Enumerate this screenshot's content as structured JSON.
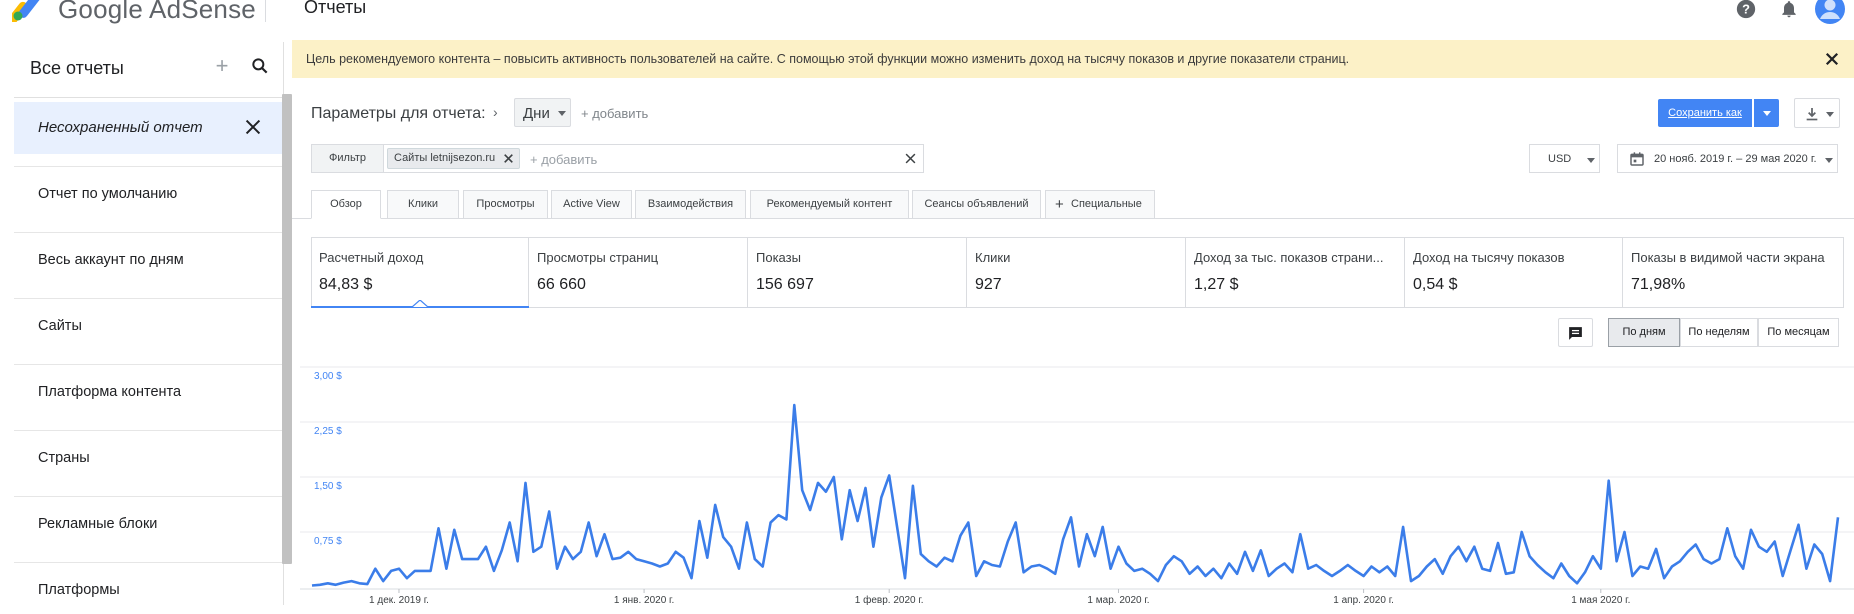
{
  "header": {
    "brand": "Google AdSense",
    "page_title": "Отчеты"
  },
  "sidebar": {
    "title": "Все отчеты",
    "active_item": "Несохраненный отчет",
    "items": [
      {
        "label": "Отчет по умолчанию"
      },
      {
        "label": "Весь аккаунт по дням"
      },
      {
        "label": "Сайты"
      },
      {
        "label": "Платформа контента"
      },
      {
        "label": "Страны"
      },
      {
        "label": "Рекламные блоки"
      },
      {
        "label": "Платформы"
      }
    ]
  },
  "banner": {
    "text": "Цель рекомендуемого контента – повысить активность пользователей на сайте. С помощью этой функции можно изменить доход на тысячу показов и другие показатели страниц."
  },
  "params": {
    "label": "Параметры для отчета:",
    "dimension": "Дни",
    "add": "+ добавить"
  },
  "toolbar": {
    "save_label": "Сохранить как"
  },
  "filter": {
    "label": "Фильтр",
    "chip": "Сайты letnijsezon.ru",
    "add": "+ добавить"
  },
  "currency": "USD",
  "date_range": "20 нояб. 2019 г. – 29 мая 2020 г.",
  "tabs": [
    {
      "label": "Обзор"
    },
    {
      "label": "Клики"
    },
    {
      "label": "Просмотры"
    },
    {
      "label": "Active View"
    },
    {
      "label": "Взаимодействия"
    },
    {
      "label": "Рекомендуемый контент"
    },
    {
      "label": "Сеансы объявлений"
    },
    {
      "label": "Специальные"
    }
  ],
  "metrics": [
    {
      "label": "Расчетный доход",
      "value": "84,83 $"
    },
    {
      "label": "Просмотры страниц",
      "value": "66 660"
    },
    {
      "label": "Показы",
      "value": "156 697"
    },
    {
      "label": "Клики",
      "value": "927"
    },
    {
      "label": "Доход за тыс. показов страни...",
      "value": "1,27 $"
    },
    {
      "label": "Доход на тысячу показов",
      "value": "0,54 $"
    },
    {
      "label": "Показы в видимой части экрана",
      "value": "71,98%"
    }
  ],
  "granularity": [
    {
      "label": "По дням"
    },
    {
      "label": "По неделям"
    },
    {
      "label": "По месяцам"
    }
  ],
  "colors": {
    "accent": "#4285f4",
    "banner_bg": "#fcf1c7",
    "series": "#3b7de9"
  },
  "chart_data": {
    "type": "line",
    "ylim": [
      0,
      3.0
    ],
    "y_ticks": [
      {
        "value": 0.75,
        "label": "0,75 $"
      },
      {
        "value": 1.5,
        "label": "1,50 $"
      },
      {
        "value": 2.25,
        "label": "2,25 $"
      },
      {
        "value": 3.0,
        "label": "3,00 $"
      }
    ],
    "x_ticks": [
      {
        "index": 11,
        "label": "1 дек. 2019 г."
      },
      {
        "index": 42,
        "label": "1 янв. 2020 г."
      },
      {
        "index": 73,
        "label": "1 февр. 2020 г."
      },
      {
        "index": 102,
        "label": "1 мар. 2020 г."
      },
      {
        "index": 133,
        "label": "1 апр. 2020 г."
      },
      {
        "index": 163,
        "label": "1 мая 2020 г."
      }
    ],
    "series": [
      {
        "values": [
          0.02,
          0.03,
          0.05,
          0.03,
          0.06,
          0.08,
          0.05,
          0.04,
          0.25,
          0.08,
          0.22,
          0.25,
          0.12,
          0.22,
          0.22,
          0.22,
          0.8,
          0.25,
          0.78,
          0.38,
          0.38,
          0.38,
          0.55,
          0.22,
          0.5,
          0.88,
          0.35,
          1.42,
          0.48,
          0.55,
          1.03,
          0.25,
          0.55,
          0.38,
          0.48,
          0.88,
          0.42,
          0.72,
          0.38,
          0.4,
          0.48,
          0.38,
          0.35,
          0.32,
          0.28,
          0.32,
          0.48,
          0.4,
          0.12,
          0.9,
          0.4,
          1.12,
          0.68,
          0.55,
          0.25,
          0.88,
          0.38,
          0.28,
          0.88,
          0.98,
          0.92,
          2.48,
          1.32,
          1.05,
          1.42,
          1.3,
          1.5,
          0.65,
          1.32,
          0.9,
          1.35,
          0.55,
          1.22,
          1.52,
          0.82,
          0.12,
          1.38,
          0.45,
          0.35,
          0.28,
          0.4,
          0.35,
          0.7,
          0.88,
          0.15,
          0.35,
          0.3,
          0.28,
          0.62,
          0.88,
          0.2,
          0.28,
          0.3,
          0.25,
          0.18,
          0.65,
          0.95,
          0.28,
          0.72,
          0.42,
          0.82,
          0.25,
          0.55,
          0.32,
          0.22,
          0.25,
          0.18,
          0.08,
          0.3,
          0.42,
          0.35,
          0.18,
          0.28,
          0.15,
          0.25,
          0.12,
          0.32,
          0.18,
          0.48,
          0.22,
          0.5,
          0.15,
          0.25,
          0.32,
          0.2,
          0.72,
          0.25,
          0.3,
          0.22,
          0.15,
          0.22,
          0.3,
          0.22,
          0.15,
          0.28,
          0.2,
          0.28,
          0.15,
          0.82,
          0.08,
          0.15,
          0.28,
          0.38,
          0.18,
          0.42,
          0.55,
          0.35,
          0.55,
          0.25,
          0.22,
          0.6,
          0.18,
          0.2,
          0.75,
          0.42,
          0.3,
          0.2,
          0.12,
          0.32,
          0.15,
          0.05,
          0.2,
          0.42,
          0.25,
          1.45,
          0.35,
          0.75,
          0.15,
          0.28,
          0.25,
          0.52,
          0.12,
          0.28,
          0.35,
          0.48,
          0.58,
          0.38,
          0.32,
          0.38,
          0.8,
          0.42,
          0.25,
          0.78,
          0.55,
          0.48,
          0.62,
          0.15,
          0.5,
          0.85,
          0.25,
          0.58,
          0.45,
          0.08,
          0.95
        ]
      }
    ]
  }
}
